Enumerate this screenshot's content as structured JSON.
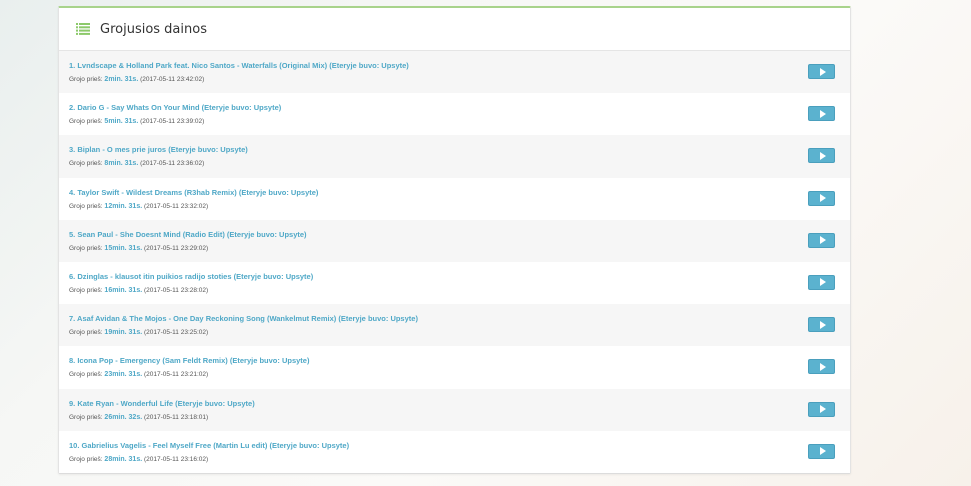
{
  "panel": {
    "title": "Grojusios dainos",
    "accent_color": "#a8d38b",
    "link_color": "#4fa8c7"
  },
  "labels": {
    "played_before": "Grojo prieš:"
  },
  "songs": [
    {
      "title": "1. Lvndscape & Holland Park feat. Nico Santos - Waterfalls (Original Mix)  (Eteryje buvo: Upsyte)",
      "ago": "2min. 31s.",
      "time": "(2017-05-11 23:42:02)"
    },
    {
      "title": "2. Dario G - Say Whats On Your Mind  (Eteryje buvo: Upsyte)",
      "ago": "5min. 31s.",
      "time": "(2017-05-11 23:39:02)"
    },
    {
      "title": "3. Biplan - O mes prie juros  (Eteryje buvo: Upsyte)",
      "ago": "8min. 31s.",
      "time": "(2017-05-11 23:36:02)"
    },
    {
      "title": "4. Taylor Swift - Wildest Dreams (R3hab Remix)  (Eteryje buvo: Upsyte)",
      "ago": "12min. 31s.",
      "time": "(2017-05-11 23:32:02)"
    },
    {
      "title": "5. Sean Paul - She Doesnt Mind (Radio Edit)  (Eteryje buvo: Upsyte)",
      "ago": "15min. 31s.",
      "time": "(2017-05-11 23:29:02)"
    },
    {
      "title": "6. Dzinglas - klausot itin puikios radijo stoties  (Eteryje buvo: Upsyte)",
      "ago": "16min. 31s.",
      "time": "(2017-05-11 23:28:02)"
    },
    {
      "title": "7. Asaf Avidan & The Mojos - One Day Reckoning Song (Wankelmut Remix)  (Eteryje buvo: Upsyte)",
      "ago": "19min. 31s.",
      "time": "(2017-05-11 23:25:02)"
    },
    {
      "title": "8. Icona Pop - Emergency (Sam Feldt Remix)  (Eteryje buvo: Upsyte)",
      "ago": "23min. 31s.",
      "time": "(2017-05-11 23:21:02)"
    },
    {
      "title": "9. Kate Ryan - Wonderful Life  (Eteryje buvo: Upsyte)",
      "ago": "26min. 32s.",
      "time": "(2017-05-11 23:18:01)"
    },
    {
      "title": "10. Gabrielius Vagelis - Feel Myself Free (Martin Lu edit)  (Eteryje buvo: Upsyte)",
      "ago": "28min. 31s.",
      "time": "(2017-05-11 23:16:02)"
    }
  ]
}
